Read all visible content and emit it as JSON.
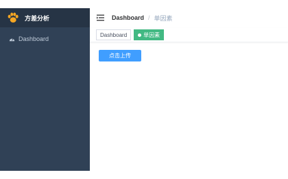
{
  "sidebar": {
    "brand": "方差分析",
    "icon": "paw-logo",
    "items": [
      {
        "label": "Dashboard",
        "icon": "dashboard-icon"
      }
    ],
    "colors": {
      "background": "#304156",
      "header": "#263445",
      "text": "#bfcbd9"
    }
  },
  "navbar": {
    "breadcrumb": [
      "Dashboard",
      "单因素"
    ],
    "separator": "/"
  },
  "tags_view": {
    "tags": [
      {
        "label": "Dashboard",
        "active": false
      },
      {
        "label": "单因素",
        "active": true
      }
    ],
    "active_color": "#42b983"
  },
  "main": {
    "upload_button": "点击上传",
    "button_color": "#409eff"
  }
}
